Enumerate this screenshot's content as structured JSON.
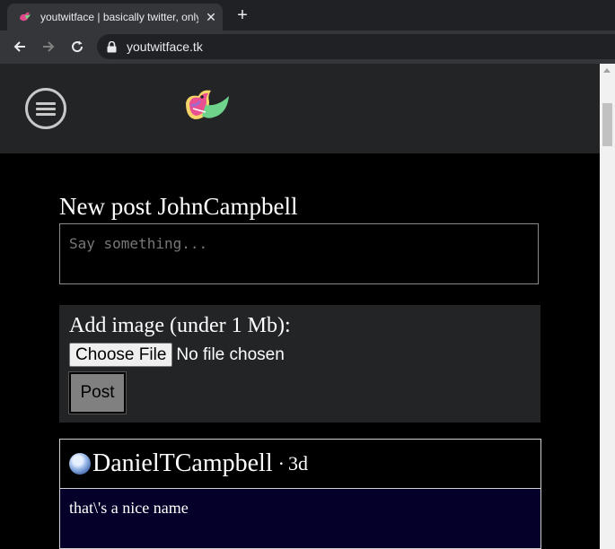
{
  "browser": {
    "tab_title": "youtwitface | basically twitter, only",
    "tab_close": "✕",
    "new_tab": "+",
    "url": "youtwitface.tk"
  },
  "composer": {
    "title": "New post JohnCampbell",
    "placeholder": "Say something...",
    "image_label": "Add image (under 1 Mb):",
    "choose_file_label": "Choose File",
    "file_status": "No file chosen",
    "post_label": "Post"
  },
  "feed": [
    {
      "author": "DanielTCampbell",
      "separator": "·",
      "age": "3d",
      "text": "that\\'s a nice name"
    }
  ],
  "colors": {
    "header_bg": "#222426",
    "page_bg": "#000000",
    "post_body_bg": "#05002a"
  }
}
